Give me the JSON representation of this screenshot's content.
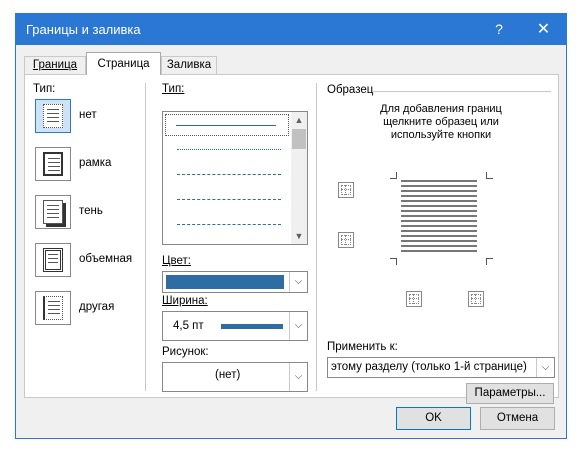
{
  "window": {
    "title": "Границы и заливка",
    "help": "?",
    "close": "✕"
  },
  "tabs": [
    {
      "label": "Граница",
      "selected": false
    },
    {
      "label": "Страница",
      "selected": true
    },
    {
      "label": "Заливка",
      "selected": false
    }
  ],
  "type_section": {
    "label": "Тип:",
    "items": [
      {
        "label": "нет",
        "selected": true
      },
      {
        "label": "рамка",
        "selected": false
      },
      {
        "label": "тень",
        "selected": false
      },
      {
        "label": "объемная",
        "selected": false
      },
      {
        "label": "другая",
        "selected": false
      }
    ]
  },
  "style_section": {
    "label": "Тип:",
    "scroll_up": "▲",
    "scroll_down": "▼"
  },
  "color": {
    "label": "Цвет:",
    "value_color": "#2e6da4"
  },
  "width": {
    "label": "Ширина:",
    "value": "4,5 пт"
  },
  "art": {
    "label": "Рисунок:",
    "value": "(нет)"
  },
  "preview": {
    "label": "Образец",
    "hint": "Для добавления границ щелкните образец или используйте кнопки"
  },
  "apply": {
    "label": "Применить к:",
    "value": "этому разделу (только 1-й странице)"
  },
  "options_button": "Параметры...",
  "ok_button": "OK",
  "cancel_button": "Отмена",
  "colors": {
    "accent": "#2b78d4",
    "selection_bg": "#cfe3f7",
    "line_blue": "#2e6da4"
  }
}
